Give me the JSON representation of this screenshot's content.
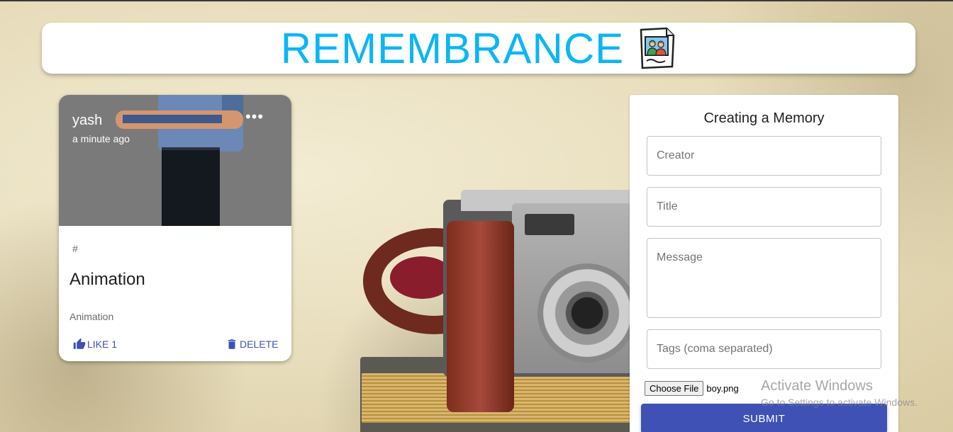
{
  "header": {
    "title": "REMEMBRANCE",
    "logo_icon": "photo-memories-icon"
  },
  "post": {
    "creator": "yash",
    "time": "a minute ago",
    "more_icon": "more-horizontal-icon",
    "more_label": "•••",
    "tags": "#",
    "title": "Animation",
    "message": "Animation",
    "like_label": "LIKE 1",
    "delete_label": "DELETE",
    "accent_color": "#3f51b5"
  },
  "form": {
    "heading": "Creating a Memory",
    "creator_placeholder": "Creator",
    "title_placeholder": "Title",
    "message_placeholder": "Message",
    "tags_placeholder": "Tags (coma separated)",
    "file_button_label": "Choose File",
    "file_name": "boy.png",
    "submit_label": "SUBMIT",
    "submit_color": "#3f51b5"
  },
  "watermark": {
    "title": "Activate Windows",
    "subtitle": "Go to Settings to activate Windows."
  },
  "colors": {
    "title": "#0bb6f5",
    "primary": "#3f51b5"
  }
}
